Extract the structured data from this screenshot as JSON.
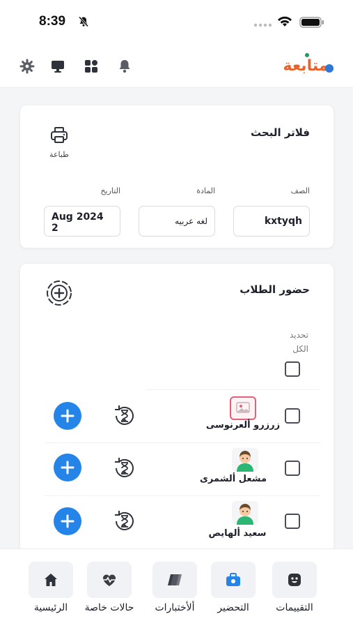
{
  "status_bar": {
    "time": "8:39"
  },
  "app": {
    "logo_text": "متابعة"
  },
  "filters": {
    "title": "فلاتر البحث",
    "print_label": "طباعة",
    "class_label": "الصف",
    "class_value": "kxtyqh",
    "subject_label": "المادة",
    "subject_value": "لغه عربيه",
    "date_label": "التاريخ",
    "date_value": "Aug 2024 2"
  },
  "attendance": {
    "title": "حضور الطلاب",
    "select_all_line1": "تحديد",
    "select_all_line2": "الكل",
    "students": [
      {
        "name": "زرزرو ألعرنوسى",
        "avatar": "photo-placeholder"
      },
      {
        "name": "مشعل ألشمرى",
        "avatar": "boy-avatar"
      },
      {
        "name": "سعيد ألهايص",
        "avatar": "boy-avatar"
      }
    ]
  },
  "bottom_nav": {
    "items": [
      {
        "label": "التقييمات",
        "icon": "rating-icon"
      },
      {
        "label": "التحضير",
        "icon": "attendance-icon"
      },
      {
        "label": "ألأختبارات",
        "icon": "exams-icon"
      },
      {
        "label": "حالات خاصة",
        "icon": "health-icon"
      },
      {
        "label": "الرئيسية",
        "icon": "home-icon"
      }
    ]
  },
  "colors": {
    "accent_blue": "#2584e8",
    "logo_orange": "#e8632b",
    "logo_blue": "#2b78d6"
  }
}
